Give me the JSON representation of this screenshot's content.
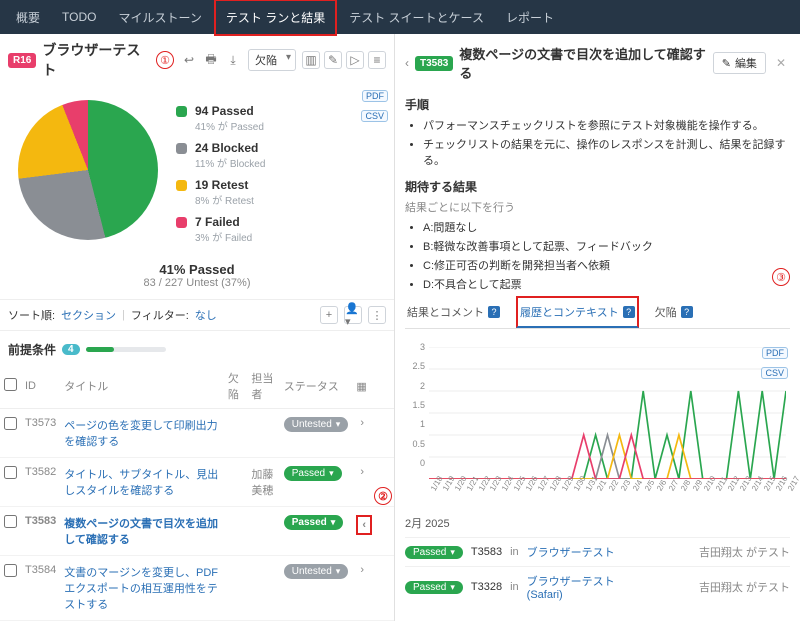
{
  "nav": {
    "tabs": [
      "概要",
      "TODO",
      "マイルストーン",
      "テスト ランと結果",
      "テスト スイートとケース",
      "レポート"
    ],
    "active_index": 3
  },
  "annotation_markers": {
    "m1": "①",
    "m2": "②",
    "m3": "③"
  },
  "left": {
    "run_badge": "R16",
    "title": "ブラウザーテスト",
    "dropdown": "欠陥",
    "export_badges": [
      "PDF",
      "CSV"
    ],
    "legend": [
      {
        "color": "#2aa64f",
        "label": "94 Passed",
        "sub": "41% が Passed"
      },
      {
        "color": "#8a8e94",
        "label": "24 Blocked",
        "sub": "11% が Blocked"
      },
      {
        "color": "#f4b80f",
        "label": "19 Retest",
        "sub": "8% が Retest"
      },
      {
        "color": "#e83e6b",
        "label": "7 Failed",
        "sub": "3% が Failed"
      }
    ],
    "summary": {
      "pct": "41% Passed",
      "sub": "83 / 227 Untest (37%)"
    },
    "filter": {
      "sort_label": "ソート順:",
      "sort_value": "セクション",
      "filter_label": "フィルター:",
      "filter_value": "なし"
    },
    "section": {
      "title": "前提条件",
      "count": "4"
    },
    "columns": {
      "id": "ID",
      "title": "タイトル",
      "defect": "欠陥",
      "assignee": "担当者",
      "status": "ステータス"
    },
    "rows": [
      {
        "id": "T3573",
        "title": "ページの色を変更して印刷出力を確認する",
        "assignee": "",
        "status": "Untested",
        "status_kind": "gray"
      },
      {
        "id": "T3582",
        "title": "タイトル、サブタイトル、見出しスタイルを確認する",
        "assignee": "加藤美穂",
        "status": "Passed",
        "status_kind": "green"
      },
      {
        "id": "T3583",
        "title": "複数ページの文書で目次を追加して確認する",
        "assignee": "",
        "status": "Passed",
        "status_kind": "green",
        "bold": true,
        "arrow_left": true
      },
      {
        "id": "T3584",
        "title": "文書のマージンを変更し、PDFエクスポートの相互運用性をテストする",
        "assignee": "",
        "status": "Untested",
        "status_kind": "gray"
      }
    ]
  },
  "right": {
    "case_badge": "T3583",
    "title": "複数ページの文書で目次を追加して確認する",
    "edit_label": "編集",
    "steps_title": "手順",
    "steps": [
      "パフォーマンスチェックリストを参照にテスト対象機能を操作する。",
      "チェックリストの結果を元に、操作のレスポンスを計測し、結果を記録する。"
    ],
    "expect_title": "期待する結果",
    "expect_lead": "結果ごとに以下を行う",
    "expect_items": [
      "A:問題なし",
      "B:軽微な改善事項として起票、フィードバック",
      "C:修正可否の判断を開発担当者へ依頼",
      "D:不具合として起票"
    ],
    "sub_tabs": [
      "結果とコメント",
      "履歴とコンテキスト",
      "欠陥"
    ],
    "active_sub": 1,
    "month_header": "2月 2025",
    "history": [
      {
        "status": "Passed",
        "id": "T3583",
        "in": "in",
        "run": "ブラウザーテスト",
        "who": "吉田翔太 がテスト"
      },
      {
        "status": "Passed",
        "id": "T3328",
        "in": "in",
        "run": "ブラウザーテスト (Safari)",
        "who": "吉田翔太 がテスト"
      }
    ]
  },
  "chart_data": {
    "type": "line",
    "ylim": [
      0,
      3
    ],
    "yticks": [
      0,
      0.5,
      1,
      1.5,
      2,
      2.5,
      3
    ],
    "categories": [
      "1/18",
      "1/19",
      "1/20",
      "1/21",
      "1/22",
      "1/23",
      "1/24",
      "1/25",
      "1/26",
      "1/27",
      "1/28",
      "1/29",
      "1/30",
      "1/31",
      "2/1",
      "2/2",
      "2/3",
      "2/4",
      "2/5",
      "2/6",
      "2/7",
      "2/8",
      "2/9",
      "2/10",
      "2/11",
      "2/12",
      "2/13",
      "2/14",
      "2/15",
      "2/16",
      "2/17"
    ],
    "series": [
      {
        "name": "Passed",
        "color": "#2aa64f",
        "values": [
          0,
          0,
          0,
          0,
          0,
          0,
          0,
          0,
          0,
          0,
          0,
          0,
          0,
          0,
          1,
          0,
          0,
          0,
          2,
          0,
          1,
          0,
          2,
          0,
          0,
          0,
          2,
          0,
          2,
          0,
          2
        ]
      },
      {
        "name": "Blocked",
        "color": "#8a8e94",
        "values": [
          0,
          0,
          0,
          0,
          0,
          0,
          0,
          0,
          0,
          0,
          0,
          0,
          0,
          0,
          0,
          1,
          0,
          0,
          0,
          0,
          0,
          0,
          0,
          0,
          0,
          0,
          0,
          0,
          0,
          0,
          0
        ]
      },
      {
        "name": "Retest",
        "color": "#f4b80f",
        "values": [
          0,
          0,
          0,
          0,
          0,
          0,
          0,
          0,
          0,
          0,
          0,
          0,
          0,
          0,
          0,
          0,
          1,
          0,
          0,
          0,
          0,
          1,
          0,
          0,
          0,
          0,
          0,
          0,
          0,
          0,
          0
        ]
      },
      {
        "name": "Failed",
        "color": "#e83e6b",
        "values": [
          0,
          0,
          0,
          0,
          0,
          0,
          0,
          0,
          0,
          0,
          0,
          0,
          0,
          1,
          0,
          0,
          0,
          1,
          0,
          0,
          0,
          0,
          0,
          0,
          0,
          0,
          0,
          0,
          0,
          0,
          0
        ]
      }
    ]
  }
}
